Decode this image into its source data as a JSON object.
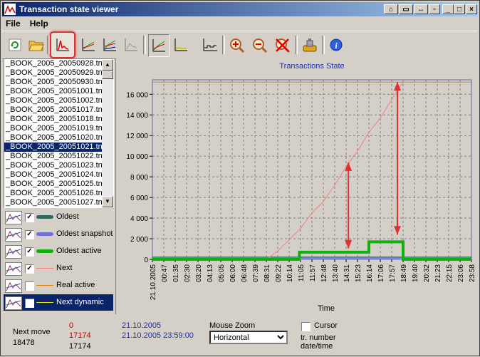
{
  "window": {
    "title": "Transaction state viewer"
  },
  "menu": [
    "File",
    "Help"
  ],
  "toolbar": {
    "buttons": [
      "refresh-icon",
      "open-folder-icon",
      "line-chart-icon",
      "multi-line-chart-icon",
      "multi-line-chart-2-icon",
      "gray-chart-icon",
      "chart-view-icon",
      "yellow-chart-icon",
      "step-chart-icon",
      "zoom-in-icon",
      "zoom-out-icon",
      "zoom-reset-icon",
      "plugin-icon",
      "info-icon"
    ]
  },
  "files": [
    "_BOOK_2005_20050928.tn",
    "_BOOK_2005_20050929.tn",
    "_BOOK_2005_20050930.tn",
    "_BOOK_2005_20051001.tn",
    "_BOOK_2005_20051002.tn",
    "_BOOK_2005_20051017.tn",
    "_BOOK_2005_20051018.tn",
    "_BOOK_2005_20051019.tn",
    "_BOOK_2005_20051020.tn",
    "_BOOK_2005_20051021.tn",
    "_BOOK_2005_20051022.tn",
    "_BOOK_2005_20051023.tn",
    "_BOOK_2005_20051024.tn",
    "_BOOK_2005_20051025.tn",
    "_BOOK_2005_20051026.tn",
    "_BOOK_2005_20051027.tn"
  ],
  "selected_file_index": 9,
  "legend": [
    {
      "label": "Oldest",
      "checked": true,
      "color": "#2e6b5e",
      "thick": true
    },
    {
      "label": "Oldest snapshot",
      "checked": true,
      "color": "#7070d8",
      "thick": true
    },
    {
      "label": "Oldest active",
      "checked": true,
      "color": "#10b010",
      "thick": true
    },
    {
      "label": "Next",
      "checked": true,
      "color": "#f08080",
      "thick": false
    },
    {
      "label": "Real active",
      "checked": false,
      "color": "#e08000",
      "thick": false
    },
    {
      "label": "Next dynamic",
      "checked": false,
      "color": "#e8e000",
      "thick": false
    }
  ],
  "bottom": {
    "next_move_label": "Next move",
    "next_move_value": "18478",
    "val_red_1": "0",
    "val_red_2": "17174",
    "val_black": "17174",
    "date1": "21.10.2005",
    "date2": "21.10.2005 23:59:00",
    "mouse_zoom_label": "Mouse Zoom",
    "zoom_options": [
      "Horizontal"
    ],
    "cursor_label": "Cursor",
    "tr_number_label": "tr. number",
    "date_time_label": "date/time"
  },
  "chart_data": {
    "type": "line",
    "title": "Transactions State",
    "xlabel": "Time",
    "ylabel": "",
    "ylim": [
      0,
      17400
    ],
    "yticks": [
      0,
      2000,
      4000,
      6000,
      8000,
      10000,
      12000,
      14000,
      16000
    ],
    "ytick_labels": [
      "0",
      "2 000",
      "4 000",
      "6 000",
      "8 000",
      "10 000",
      "12 000",
      "14 000",
      "16 000"
    ],
    "xtick_labels": [
      "21.10.2005",
      "00:47",
      "01:35",
      "02:30",
      "03:20",
      "04:13",
      "05:05",
      "06:00",
      "06:48",
      "07:39",
      "08:31",
      "09:22",
      "10:14",
      "11:05",
      "11:57",
      "12:48",
      "13:40",
      "14:31",
      "15:23",
      "16:14",
      "17:06",
      "17:57",
      "18:49",
      "19:40",
      "20:32",
      "21:23",
      "22:15",
      "23:06",
      "23:58"
    ],
    "series": [
      {
        "name": "Next",
        "color": "#f08080",
        "width": 1,
        "x": [
          0,
          10,
          11,
          12,
          13,
          14,
          15,
          16,
          17,
          18,
          19,
          20,
          21,
          22
        ],
        "y": [
          0,
          0,
          800,
          1900,
          3000,
          4500,
          5600,
          7200,
          9000,
          10500,
          12300,
          13700,
          15500,
          17174
        ]
      },
      {
        "name": "Oldest active",
        "color": "#10b010",
        "width": 4,
        "x": [
          0,
          12.9,
          12.9,
          19,
          19,
          22,
          22,
          28
        ],
        "y": [
          0,
          0,
          700,
          700,
          1700,
          1700,
          0,
          0
        ]
      },
      {
        "name": "Oldest",
        "color": "#2e6b5e",
        "width": 2,
        "x": [
          0,
          28
        ],
        "y": [
          200,
          200
        ]
      },
      {
        "name": "Oldest snapshot",
        "color": "#7070d8",
        "width": 2,
        "x": [
          0,
          28
        ],
        "y": [
          150,
          150
        ]
      },
      {
        "name": "Limit",
        "color": "#e08000",
        "width": 1,
        "x": [
          0,
          28
        ],
        "y": [
          17174,
          17174
        ]
      }
    ],
    "annotations": [
      {
        "type": "double-arrow",
        "x": 17.2,
        "y1": 1050,
        "y2": 9400,
        "color": "#e03030"
      },
      {
        "type": "double-arrow",
        "x": 21.5,
        "y1": 2400,
        "y2": 17174,
        "color": "#e03030"
      }
    ]
  }
}
